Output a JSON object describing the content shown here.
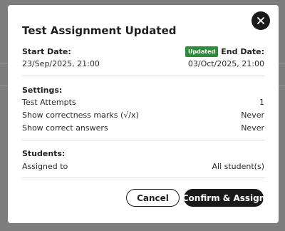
{
  "dialog": {
    "title": "Test Assignment Updated",
    "start": {
      "label": "Start Date:",
      "value": "23/Sep/2025, 21:00"
    },
    "end": {
      "badge": "Updated",
      "label": "End Date:",
      "value": "03/Oct/2025, 21:00"
    },
    "settings": {
      "heading": "Settings:",
      "rows": [
        {
          "label": "Test Attempts",
          "value": "1"
        },
        {
          "label": "Show correctness marks (√/x)",
          "value": "Never"
        },
        {
          "label": "Show correct answers",
          "value": "Never"
        }
      ]
    },
    "students": {
      "heading": "Students:",
      "rows": [
        {
          "label": "Assigned to",
          "value": "All student(s)"
        }
      ]
    },
    "buttons": {
      "cancel": "Cancel",
      "confirm": "Confirm & Assign"
    },
    "close_icon": "close-icon",
    "colors": {
      "badge": "#2e8b3a",
      "primary": "#1a1a1a",
      "overlay": "#7d7d7d"
    }
  }
}
